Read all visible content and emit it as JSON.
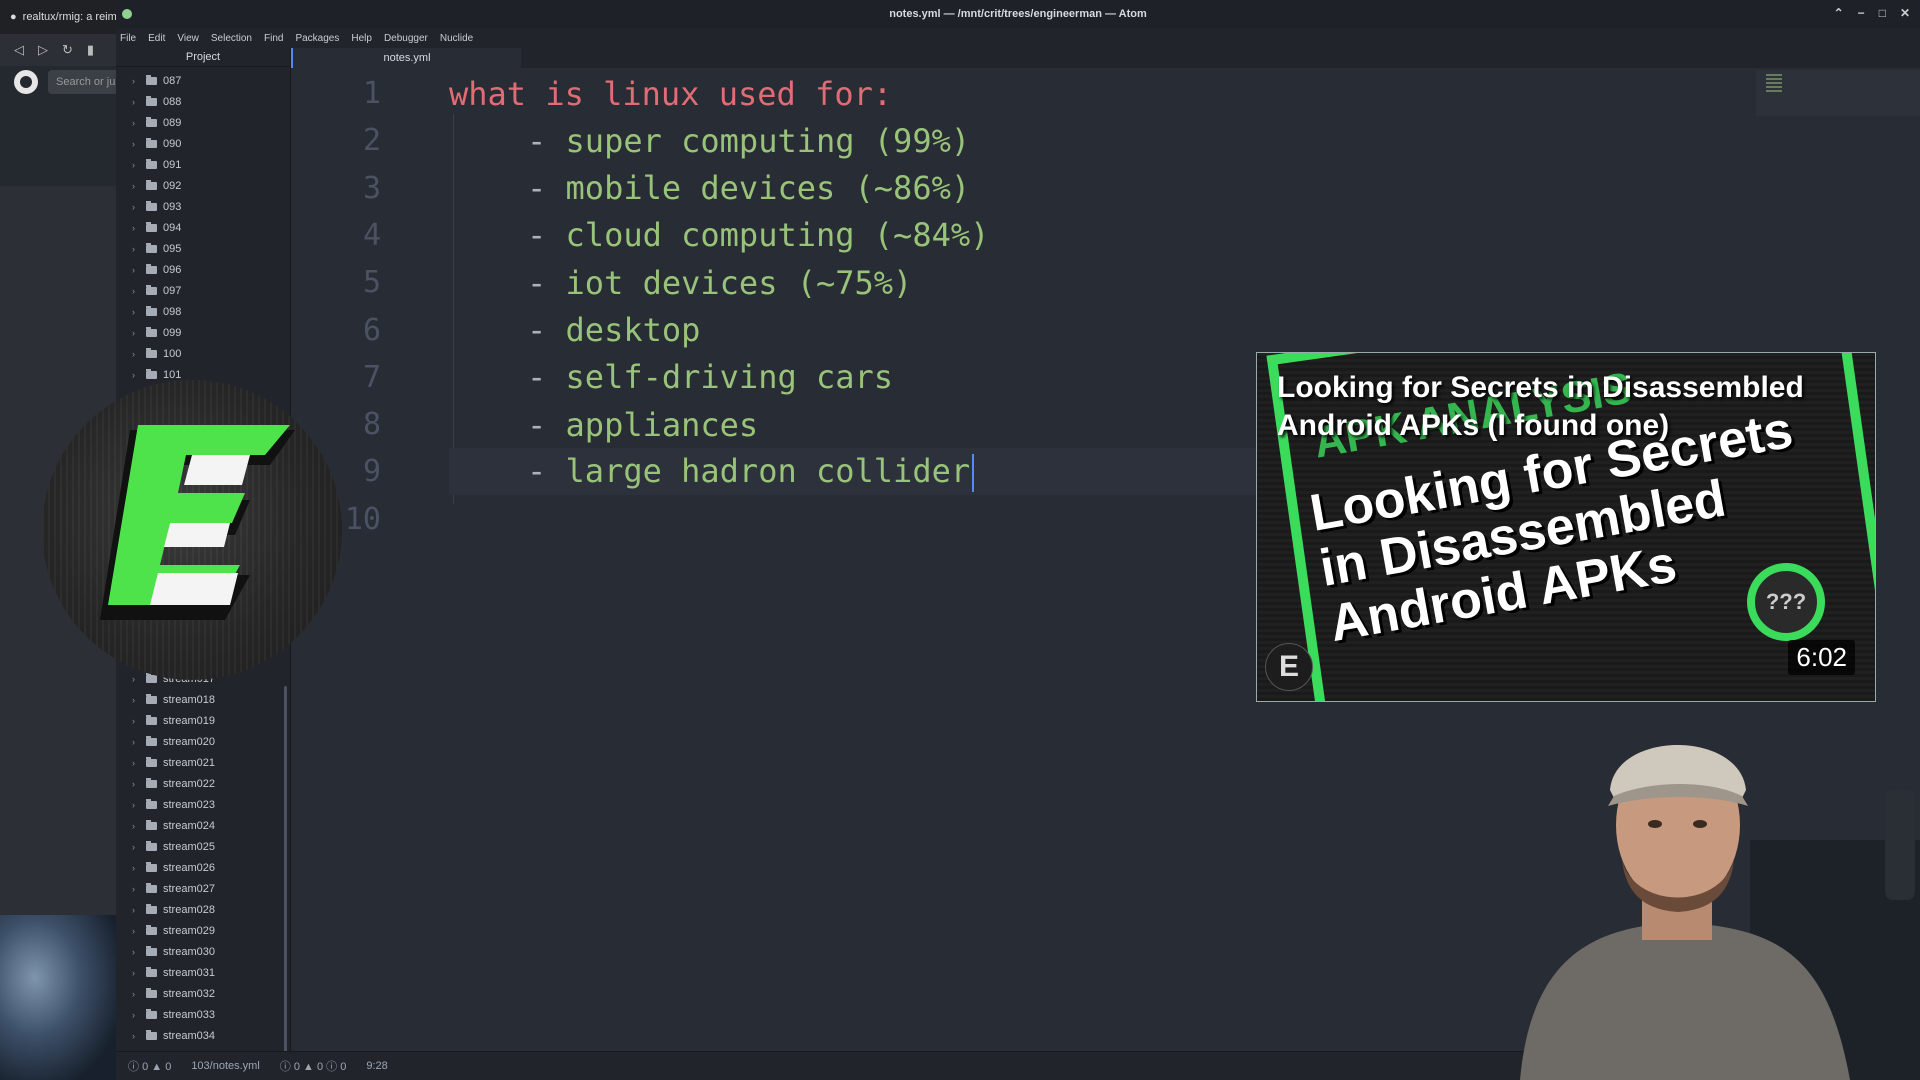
{
  "browser": {
    "tab_title": "realtux/rmig: a reim",
    "search_placeholder": "Search or ju"
  },
  "window": {
    "title": "notes.yml — /mnt/crit/trees/engineerman — Atom",
    "controls": [
      "⌃",
      "−",
      "□",
      "✕"
    ]
  },
  "menu": [
    "File",
    "Edit",
    "View",
    "Selection",
    "Find",
    "Packages",
    "Help",
    "Debugger",
    "Nuclide"
  ],
  "tree": {
    "header": "Project",
    "top_items": [
      "087",
      "088",
      "089",
      "090",
      "091",
      "092",
      "093",
      "094",
      "095",
      "096",
      "097",
      "098",
      "099",
      "100",
      "101"
    ],
    "bottom_items": [
      "stream017",
      "stream018",
      "stream019",
      "stream020",
      "stream021",
      "stream022",
      "stream023",
      "stream024",
      "stream025",
      "stream026",
      "stream027",
      "stream028",
      "stream029",
      "stream030",
      "stream031",
      "stream032",
      "stream033",
      "stream034"
    ]
  },
  "tab": {
    "label": "notes.yml"
  },
  "editor": {
    "lines": [
      {
        "num": "1",
        "text": "what is linux used for:",
        "kind": "key"
      },
      {
        "num": "2",
        "text": "super computing (99%)",
        "kind": "item"
      },
      {
        "num": "3",
        "text": "mobile devices (~86%)",
        "kind": "item"
      },
      {
        "num": "4",
        "text": "cloud computing (~84%)",
        "kind": "item"
      },
      {
        "num": "5",
        "text": "iot devices (~75%)",
        "kind": "item"
      },
      {
        "num": "6",
        "text": "desktop",
        "kind": "item"
      },
      {
        "num": "7",
        "text": "self-driving cars",
        "kind": "item"
      },
      {
        "num": "8",
        "text": "appliances",
        "kind": "item"
      },
      {
        "num": "9",
        "text": "large hadron collider",
        "kind": "item"
      },
      {
        "num": "10",
        "text": "",
        "kind": "empty"
      }
    ],
    "cursor_line": 9
  },
  "status": {
    "errors": "0",
    "warnings": "0",
    "file": "103/notes.yml",
    "diagnostics": "0 ▲ 0 ⓘ 0",
    "position": "9:28"
  },
  "thumbnail": {
    "title": "Looking for Secrets in Disassembled Android APKs (I found one)",
    "art_top": "APK ANALYSIS",
    "art_text": "Looking for Secrets\nin Disassembled\nAndroid APKs",
    "badge": "???",
    "channel_letter": "E",
    "duration": "6:02"
  },
  "colors": {
    "key": "#e06c75",
    "item": "#98c379",
    "accent": "#3bdc5c",
    "cursor": "#528bff"
  }
}
